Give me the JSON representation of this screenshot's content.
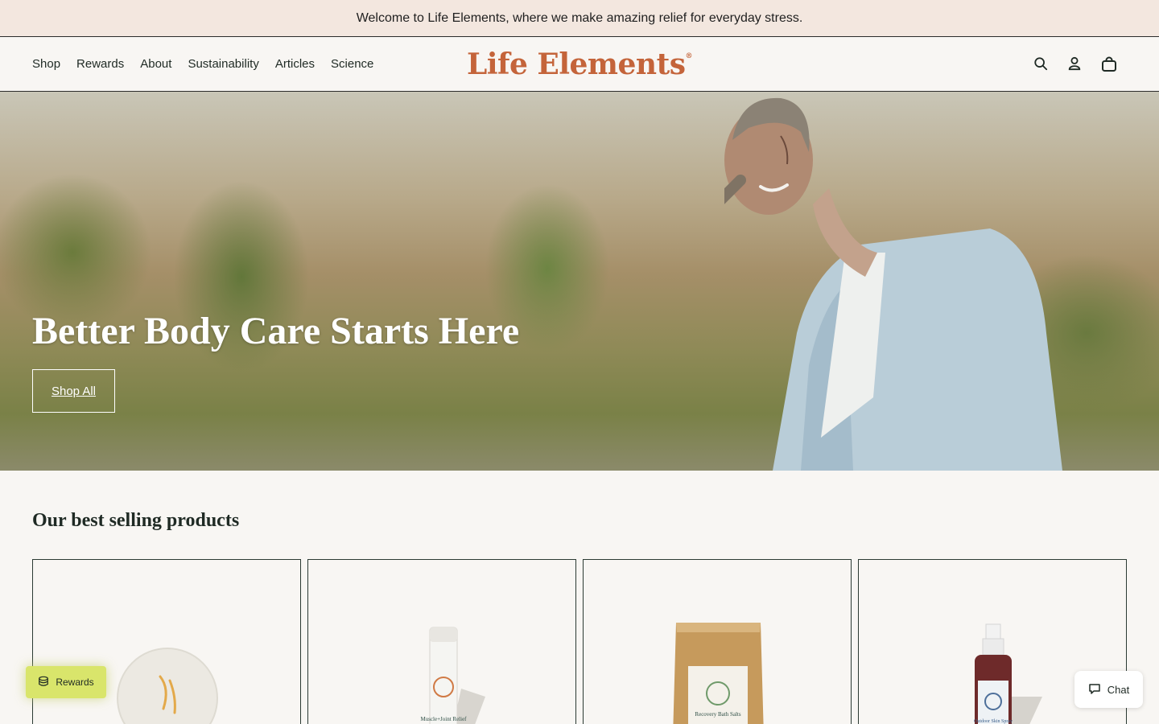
{
  "announcement": {
    "text": "Welcome to Life Elements, where we make amazing relief for everyday stress."
  },
  "header": {
    "nav": [
      {
        "label": "Shop"
      },
      {
        "label": "Rewards"
      },
      {
        "label": "About"
      },
      {
        "label": "Sustainability"
      },
      {
        "label": "Articles"
      },
      {
        "label": "Science"
      }
    ],
    "logo_text": "Life Elements",
    "logo_mark": "®",
    "icons": [
      "search-icon",
      "account-icon",
      "cart-icon"
    ]
  },
  "hero": {
    "title": "Better Body Care Starts Here",
    "button_label": "Shop All"
  },
  "best_sellers": {
    "title": "Our best selling products",
    "products": [
      {
        "image": "bath-bomb"
      },
      {
        "image": "muscle-joint-relief-stick",
        "label": "Muscle+Joint Relief"
      },
      {
        "image": "recovery-bath-salts-pouch",
        "label": "Recovery Bath Salts"
      },
      {
        "image": "outdoor-spray-bottle",
        "label": "Outdoor Skin Spray"
      }
    ]
  },
  "widgets": {
    "rewards_label": "Rewards",
    "chat_label": "Chat"
  },
  "colors": {
    "announcement_bg": "#f3e7df",
    "logo": "#c4643a",
    "rewards_bg": "#d9e56b",
    "page_bg": "#f8f6f3"
  }
}
